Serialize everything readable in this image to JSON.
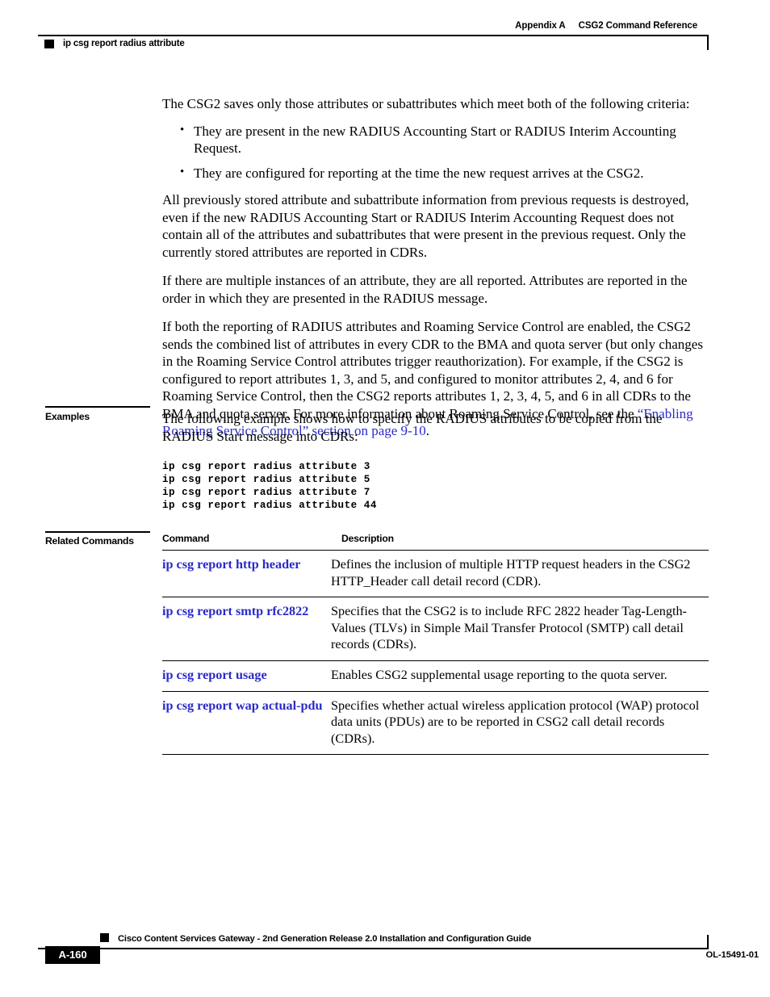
{
  "header": {
    "appendix_label": "Appendix A",
    "running_title": "CSG2 Command Reference",
    "command_name": "ip csg report radius attribute"
  },
  "body": {
    "intro_paragraph": "The CSG2 saves only those attributes or subattributes which meet both of the following criteria:",
    "bullets": [
      "They are present in the new RADIUS Accounting Start or RADIUS Interim Accounting Request.",
      "They are configured for reporting at the time the new request arrives at the CSG2."
    ],
    "paragraph_2": "All previously stored attribute and subattribute information from previous requests is destroyed, even if the new RADIUS Accounting Start or RADIUS Interim Accounting Request does not contain all of the attributes and subattributes that were present in the previous request. Only the currently stored attributes are reported in CDRs.",
    "paragraph_3": "If there are multiple instances of an attribute, they are all reported. Attributes are reported in the order in which they are presented in the RADIUS message.",
    "paragraph_4_prefix": "If both the reporting of RADIUS attributes and Roaming Service Control are enabled, the CSG2 sends the combined list of attributes in every CDR to the BMA and quota server (but only changes in the Roaming Service Control attributes trigger reauthorization). For example, if the CSG2 is configured to report attributes 1, 3, and 5, and configured to monitor attributes 2, 4, and 6 for Roaming Service Control, then the CSG2 reports attributes 1, 2, 3, 4, 5, and 6 in all CDRs to the BMA and quota server. For more information about Roaming Service Control, see the ",
    "paragraph_4_link": "“Enabling Roaming Service Control” section on page 9-10",
    "paragraph_4_suffix": "."
  },
  "examples": {
    "label": "Examples",
    "intro": "The following example shows how to specify the RADIUS attributes to be copied from the RADIUS Start message into CDRs:",
    "code": "ip csg report radius attribute 3\nip csg report radius attribute 5\nip csg report radius attribute 7\nip csg report radius attribute 44"
  },
  "related_commands": {
    "label": "Related Commands",
    "columns": [
      "Command",
      "Description"
    ],
    "rows": [
      {
        "command": "ip csg report http header",
        "description": "Defines the inclusion of multiple HTTP request headers in the CSG2 HTTP_Header call detail record (CDR)."
      },
      {
        "command": "ip csg report smtp rfc2822",
        "description": "Specifies that the CSG2 is to include RFC 2822 header Tag-Length-Values (TLVs) in Simple Mail Transfer Protocol (SMTP) call detail records (CDRs)."
      },
      {
        "command": "ip csg report usage",
        "description": "Enables CSG2 supplemental usage reporting to the quota server."
      },
      {
        "command": "ip csg report wap actual-pdu",
        "description": "Specifies whether actual wireless application protocol (WAP) protocol data units (PDUs) are to be reported in CSG2 call detail records (CDRs)."
      }
    ]
  },
  "footer": {
    "guide_title": "Cisco Content Services Gateway - 2nd Generation Release 2.0 Installation and Configuration Guide",
    "page_number": "A-160",
    "document_number": "OL-15491-01"
  },
  "colors": {
    "link": "#2a2ac8",
    "rule": "#000000",
    "page_background": "#ffffff"
  }
}
